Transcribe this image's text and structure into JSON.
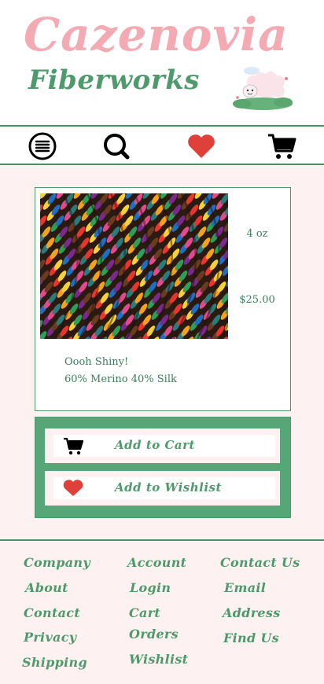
{
  "header": {
    "brand_line1": "Cazenovia",
    "brand_line2": "Fiberworks",
    "mascot_icon": "sheep-on-grass-icon"
  },
  "nav": {
    "items": [
      "menu-icon",
      "search-icon",
      "heart-icon",
      "cart-icon"
    ],
    "heart_color": "#e0403a"
  },
  "product": {
    "image_icon": "rainbow-yarn-skein-image",
    "weight": "4 oz",
    "price": "$25.00",
    "name": "Oooh Shiny!",
    "fiber": "60% Merino 40% Silk"
  },
  "actions": {
    "add_to_cart": "Add to Cart",
    "add_to_wishlist": "Add to Wishlist"
  },
  "footer": {
    "col1": [
      "Company",
      "About",
      "Contact",
      "Privacy",
      "Shipping"
    ],
    "col2": [
      "Account",
      "Login",
      "Cart",
      "Orders",
      "Wishlist"
    ],
    "col3": [
      "Contact Us",
      "Email",
      "Address",
      "Find Us"
    ]
  },
  "colors": {
    "brand_pink": "#f4aab2",
    "brand_green": "#4e9a6c",
    "panel_green": "#57a678",
    "background": "#fdf1f1"
  }
}
